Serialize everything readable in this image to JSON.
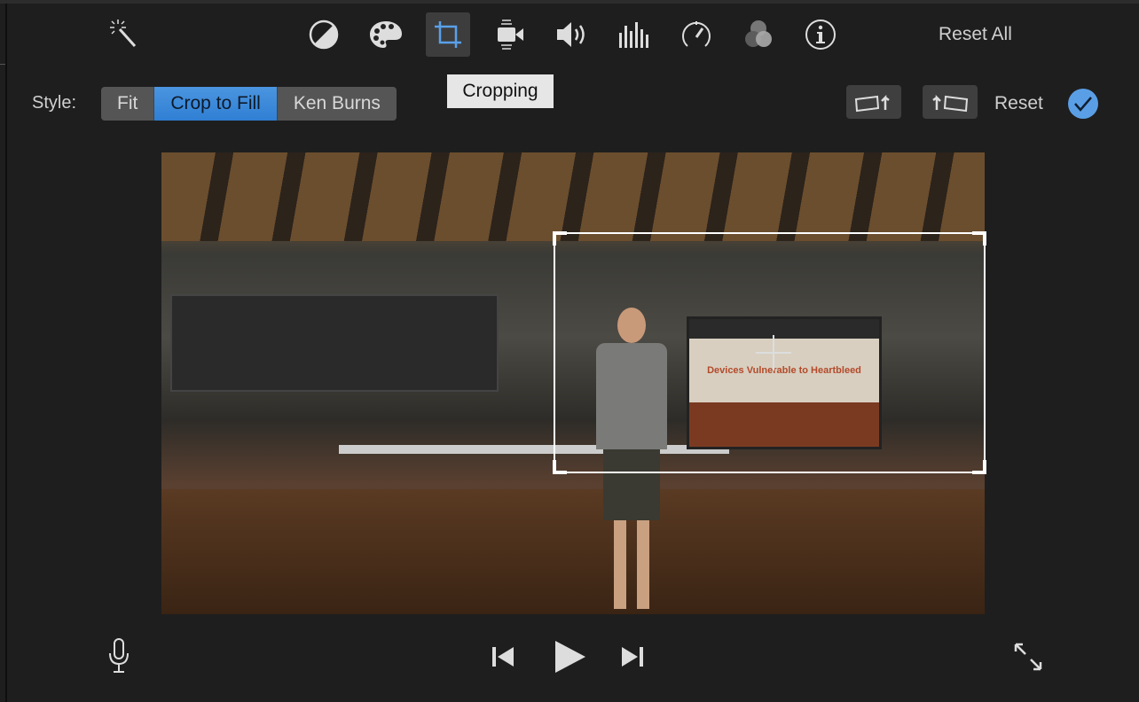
{
  "toolbar": {
    "icons": [
      "magic-wand-icon",
      "color-balance-icon",
      "color-correction-icon",
      "crop-icon",
      "stabilization-icon",
      "volume-icon",
      "noise-reduction-icon",
      "speed-icon",
      "clip-filter-icon",
      "info-icon"
    ],
    "active": "crop-icon",
    "reset_all": "Reset All",
    "accent": "#4a90d9"
  },
  "crop": {
    "style_label": "Style:",
    "styles": [
      "Fit",
      "Crop to Fill",
      "Ken Burns"
    ],
    "selected_style": "Crop to Fill",
    "tooltip": "Cropping",
    "reset": "Reset"
  },
  "video": {
    "screen_text": "Devices Vulnerable to Heartbleed"
  },
  "playback": {
    "icons": [
      "microphone-icon",
      "skip-back-icon",
      "play-icon",
      "skip-forward-icon",
      "fullscreen-icon"
    ]
  }
}
